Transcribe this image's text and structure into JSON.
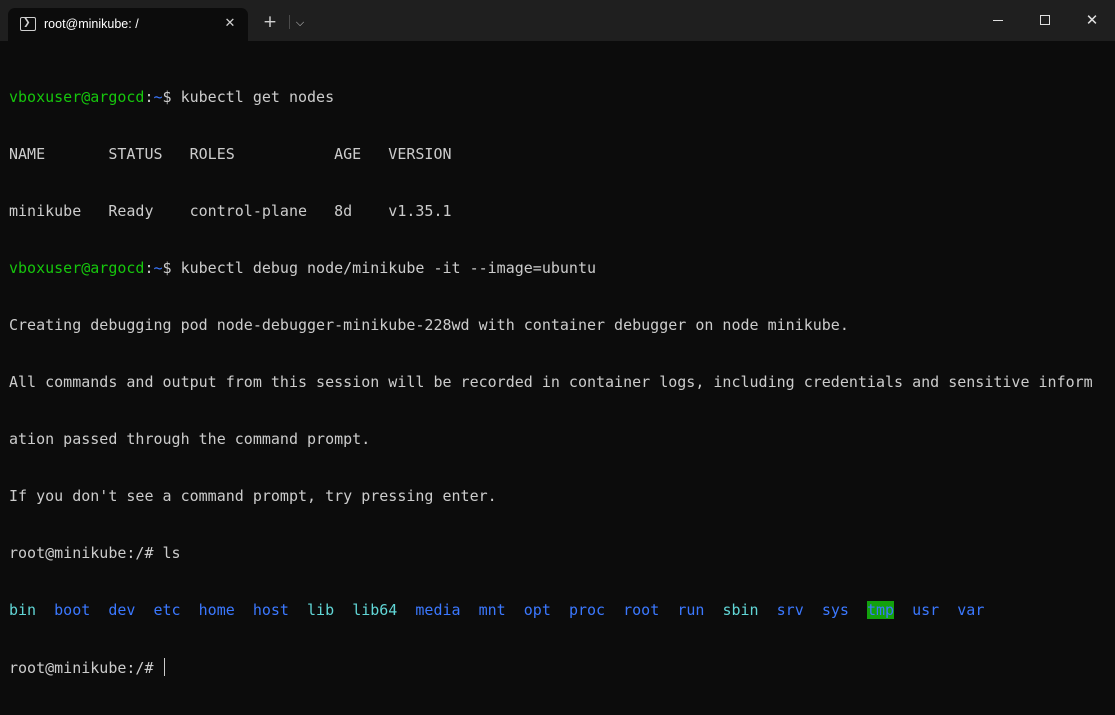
{
  "window": {
    "tab_title": "root@minikube: /",
    "tab_icon": "powershell-icon",
    "new_tab": "+",
    "dropdown": "⌵",
    "close": "✕"
  },
  "terminal": {
    "prompt1": {
      "user": "vboxuser@argocd",
      "sep": ":",
      "path": "~",
      "sym": "$ ",
      "cmd": "kubectl get nodes"
    },
    "table_header": "NAME       STATUS   ROLES           AGE   VERSION",
    "table_row": "minikube   Ready    control-plane   8d    v1.35.1",
    "prompt2": {
      "user": "vboxuser@argocd",
      "sep": ":",
      "path": "~",
      "sym": "$ ",
      "cmd": "kubectl debug node/minikube -it --image=ubuntu"
    },
    "output_lines": [
      "Creating debugging pod node-debugger-minikube-228wd with container debugger on node minikube.",
      "All commands and output from this session will be recorded in container logs, including credentials and sensitive inform",
      "ation passed through the command prompt.",
      "If you don't see a command prompt, try pressing enter."
    ],
    "root_prompt": "root@minikube:/# ",
    "ls_cmd": "ls",
    "ls_entries": [
      {
        "name": "bin",
        "kind": "link"
      },
      {
        "name": "boot",
        "kind": "dir"
      },
      {
        "name": "dev",
        "kind": "dir"
      },
      {
        "name": "etc",
        "kind": "dir"
      },
      {
        "name": "home",
        "kind": "dir"
      },
      {
        "name": "host",
        "kind": "dir"
      },
      {
        "name": "lib",
        "kind": "link"
      },
      {
        "name": "lib64",
        "kind": "link"
      },
      {
        "name": "media",
        "kind": "dir"
      },
      {
        "name": "mnt",
        "kind": "dir"
      },
      {
        "name": "opt",
        "kind": "dir"
      },
      {
        "name": "proc",
        "kind": "dir"
      },
      {
        "name": "root",
        "kind": "dir"
      },
      {
        "name": "run",
        "kind": "dir"
      },
      {
        "name": "sbin",
        "kind": "link"
      },
      {
        "name": "srv",
        "kind": "dir"
      },
      {
        "name": "sys",
        "kind": "dir"
      },
      {
        "name": "tmp",
        "kind": "sticky"
      },
      {
        "name": "usr",
        "kind": "dir"
      },
      {
        "name": "var",
        "kind": "dir"
      }
    ],
    "final_prompt": "root@minikube:/# "
  },
  "colors": {
    "background": "#0c0c0c",
    "titlebar": "#1f1f1f",
    "text": "#cccccc",
    "user_green": "#16c60c",
    "path_blue": "#3b78ff",
    "link_cyan": "#61d6d6",
    "sticky_bg": "#13a10e"
  }
}
